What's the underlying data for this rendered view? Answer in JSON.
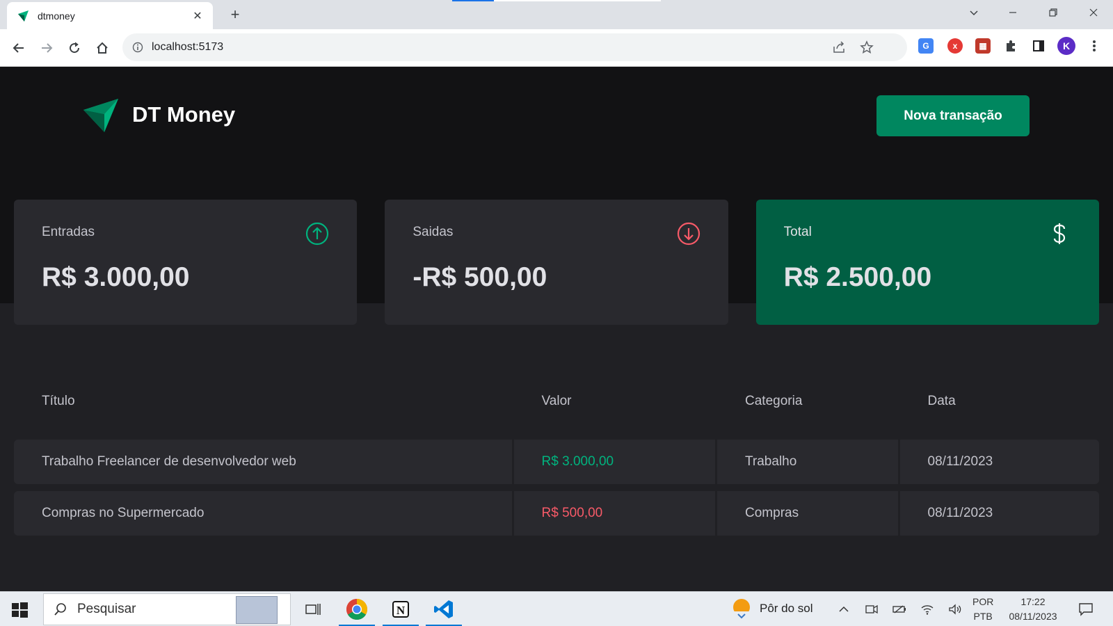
{
  "browser": {
    "tab_title": "dtmoney",
    "tab_close": "✕",
    "new_tab": "+",
    "url": "localhost:5173",
    "profile_initial": "K"
  },
  "app": {
    "logo_text": "DT Money",
    "new_transaction_label": "Nova transação",
    "summary": {
      "income_label": "Entradas",
      "income_value": "R$ 3.000,00",
      "outcome_label": "Saidas",
      "outcome_value": "-R$ 500,00",
      "total_label": "Total",
      "total_value": "R$ 2.500,00"
    },
    "table": {
      "headers": [
        "Título",
        "Valor",
        "Categoria",
        "Data"
      ],
      "rows": [
        {
          "title": "Trabalho Freelancer de desenvolvedor web",
          "value": "R$ 3.000,00",
          "type": "income",
          "category": "Trabalho",
          "date": "08/11/2023"
        },
        {
          "title": "Compras no Supermercado",
          "value": "R$ 500,00",
          "type": "outcome",
          "category": "Compras",
          "date": "08/11/2023"
        }
      ]
    },
    "colors": {
      "income": "#00b37e",
      "outcome": "#f75a68",
      "brand": "#00875f",
      "total_card": "#015f43"
    }
  },
  "taskbar": {
    "search_placeholder": "Pesquisar",
    "weather_text": "Pôr do sol",
    "lang_top": "POR",
    "lang_bottom": "PTB",
    "time": "17:22",
    "date": "08/11/2023"
  }
}
